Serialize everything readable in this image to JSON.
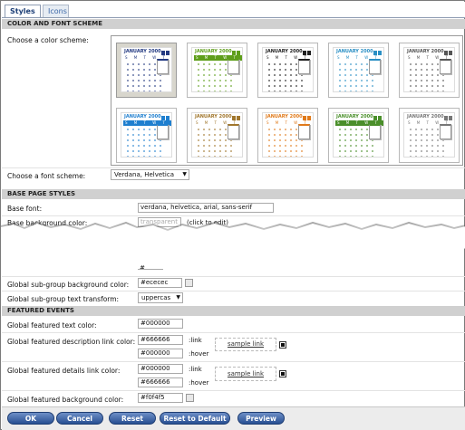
{
  "tabs": [
    {
      "label": "Styles"
    },
    {
      "label": "Icons"
    }
  ],
  "sections": {
    "color_font": "COLOR AND FONT SCHEME",
    "base_page": "BASE PAGE STYLES",
    "featured": "FEATURED EVENTS"
  },
  "color_scheme": {
    "label": "Choose a color scheme:",
    "month_label": "JANUARY 2000",
    "weekdays": "S M T W T",
    "selected_index": 0,
    "schemes": [
      {
        "accent": "#233a82"
      },
      {
        "accent": "#5e9e1a"
      },
      {
        "accent": "#1e1e1e"
      },
      {
        "accent": "#2a8fc4"
      },
      {
        "accent": "#555555"
      },
      {
        "accent": "#1f7fcf"
      },
      {
        "accent": "#a0762c"
      },
      {
        "accent": "#e07a1a"
      },
      {
        "accent": "#4a8f2a"
      },
      {
        "accent": "#777777"
      }
    ]
  },
  "font_scheme": {
    "label": "Choose a font scheme:",
    "value": "Verdana, Helvetica"
  },
  "base_font": {
    "label": "Base font:",
    "value": "verdana, helvetica, arial, sans-serif"
  },
  "base_bg": {
    "label": "Base background color:",
    "value": "transparent",
    "hint": "(click to edit)"
  },
  "partial_row_value": "#",
  "subgroup_bg": {
    "label": "Global sub-group background color:",
    "value": "#ececec"
  },
  "subgroup_transform": {
    "label": "Global sub-group text transform:",
    "value": "uppercas"
  },
  "featured_text": {
    "label": "Global featured text color:",
    "value": "#000000"
  },
  "featured_desc": {
    "label": "Global featured description link color:",
    "link_value": "#666666",
    "link_label": ":link",
    "hover_value": "#000000",
    "hover_label": ":hover",
    "sample": "sample link"
  },
  "featured_details": {
    "label": "Global featured details link color:",
    "link_value": "#000000",
    "link_label": ":link",
    "hover_value": "#666666",
    "hover_label": ":hover",
    "sample": "sample link"
  },
  "featured_bg": {
    "label": "Global featured background color:",
    "value": "#f0f4f5"
  },
  "buttons": {
    "ok": "OK",
    "cancel": "Cancel",
    "reset": "Reset",
    "reset_default": "Reset to Default",
    "preview": "Preview"
  }
}
